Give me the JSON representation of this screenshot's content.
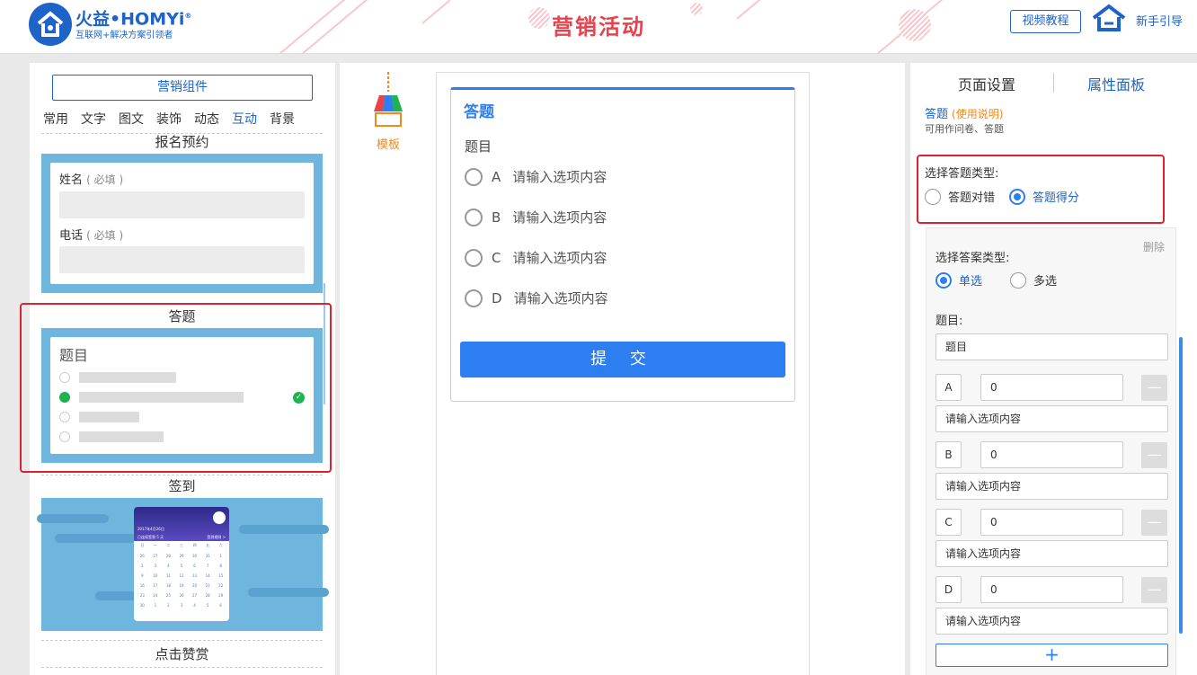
{
  "header": {
    "logo_name": "火益•HOMYi",
    "logo_reg": "®",
    "logo_sub": "互联网+解决方案引领者",
    "title": "营销活动",
    "video_btn": "视频教程",
    "guide_btn": "新手引导"
  },
  "left": {
    "components_btn": "营销组件",
    "tabs": [
      "常用",
      "文字",
      "图文",
      "装饰",
      "动态",
      "互动",
      "背景"
    ],
    "active_tab": "互动",
    "sections": {
      "signup": "报名预约",
      "quiz": "答题",
      "checkin": "签到",
      "like": "点击赞赏"
    },
    "signup_fields": {
      "name": "姓名",
      "phone": "电话",
      "required": "( 必填 )"
    },
    "quiz_preview_title": "题目",
    "calendar": {
      "date": "2017年4月26日",
      "sub": "已连续签到 5 天",
      "rule": "签到规则 >",
      "weekdays": [
        "日",
        "一",
        "二",
        "三",
        "四",
        "五",
        "六"
      ],
      "days": [
        "26",
        "27",
        "28",
        "29",
        "30",
        "31",
        "1",
        "2",
        "3",
        "4",
        "5",
        "6",
        "7",
        "8",
        "9",
        "10",
        "11",
        "12",
        "13",
        "14",
        "15",
        "16",
        "17",
        "18",
        "19",
        "20",
        "21",
        "22",
        "23",
        "24",
        "25",
        "26",
        "27",
        "28",
        "29",
        "30",
        "1",
        "2",
        "3",
        "4",
        "5",
        "6"
      ]
    }
  },
  "middle": {
    "template_label": "模板",
    "card_title": "答题",
    "question": "题目",
    "options": [
      {
        "letter": "A",
        "text": "请输入选项内容"
      },
      {
        "letter": "B",
        "text": "请输入选项内容"
      },
      {
        "letter": "C",
        "text": "请输入选项内容"
      },
      {
        "letter": "D",
        "text": "请输入选项内容"
      }
    ],
    "submit": "提 交"
  },
  "right": {
    "tab_page": "页面设置",
    "tab_props": "属性面板",
    "component": "答题",
    "help": "(使用说明)",
    "desc": "可用作问卷、答题",
    "quiz_type_label": "选择答题类型:",
    "quiz_types": [
      "答题对错",
      "答题得分"
    ],
    "quiz_type_selected": "答题得分",
    "delete": "删除",
    "answer_type_label": "选择答案类型:",
    "answer_types": [
      "单选",
      "多选"
    ],
    "answer_type_selected": "单选",
    "question_label": "题目:",
    "question_value": "题目",
    "options": [
      {
        "letter": "A",
        "score": "0",
        "text": "请输入选项内容"
      },
      {
        "letter": "B",
        "score": "0",
        "text": "请输入选项内容"
      },
      {
        "letter": "C",
        "score": "0",
        "text": "请输入选项内容"
      },
      {
        "letter": "D",
        "score": "0",
        "text": "请输入选项内容"
      }
    ],
    "minus": "—",
    "plus": "+"
  },
  "colors": {
    "brand": "#1e64c8",
    "accent": "#2d7ef0",
    "title_red": "#e8424c",
    "highlight": "#e02030",
    "template_blue": "#6eb6dd"
  }
}
